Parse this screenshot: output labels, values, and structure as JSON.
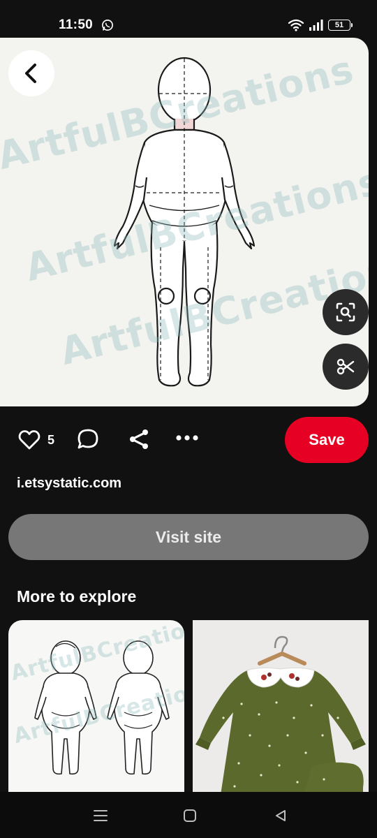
{
  "status_bar": {
    "time": "11:50",
    "battery": "51",
    "icons": [
      "whatsapp-icon",
      "wifi-icon",
      "signal-icon",
      "battery-icon"
    ]
  },
  "pin": {
    "image_watermark": "ArtfulBCreations",
    "like_count": "5",
    "save_label": "Save",
    "source_domain": "i.etsystatic.com",
    "visit_label": "Visit site"
  },
  "more": {
    "title": "More to explore",
    "card1_watermark": "ArtfulBCreations"
  },
  "colors": {
    "background": "#111111",
    "save_red": "#e60023",
    "visit_gray": "#777777",
    "float_button": "#2b2b2b",
    "dress_green": "#5b6a2c"
  }
}
